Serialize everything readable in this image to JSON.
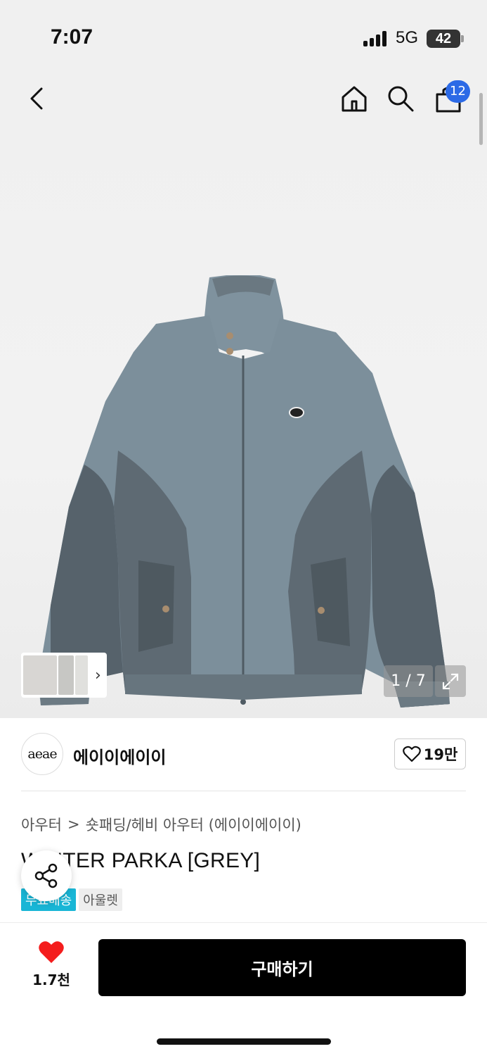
{
  "status_bar": {
    "time": "7:07",
    "network": "5G",
    "battery": "42"
  },
  "header": {
    "icons": {
      "back": "chevron-left-icon",
      "home": "home-icon",
      "search": "search-icon",
      "cart": "shopping-bag-icon"
    },
    "cart_count": "12"
  },
  "gallery": {
    "counter": "1 / 7",
    "expand_icon": "expand-icon"
  },
  "brand": {
    "logo_text": "aeae",
    "name": "에이이에이이",
    "likes": "19만"
  },
  "breadcrumb": {
    "category": "아우터",
    "separator": ">",
    "subcategory": "숏패딩/헤비 아우터 (에이이에이이)"
  },
  "product": {
    "title": "WINTER PARKA [GREY]"
  },
  "badges": {
    "free_shipping": "무료배송",
    "outlet": "아울렛"
  },
  "bottom_bar": {
    "wish_count": "1.7천",
    "buy_label": "구매하기"
  },
  "colors": {
    "accent_blue": "#2c6ae6",
    "badge_cyan": "#19b6d6",
    "heart_red": "#f41d1d",
    "buy_black": "#000000"
  }
}
